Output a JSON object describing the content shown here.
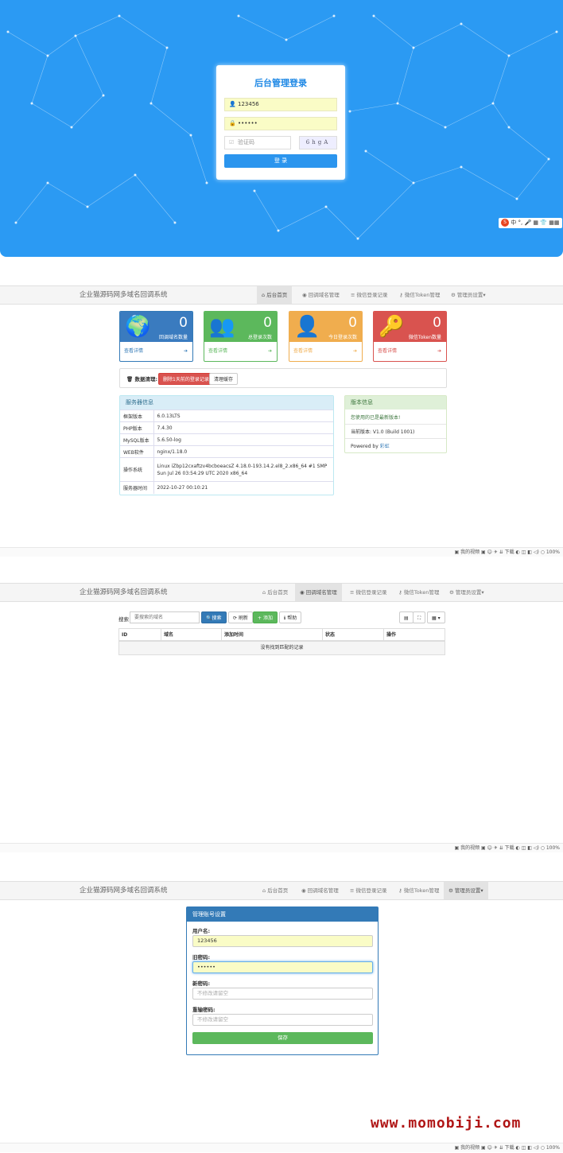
{
  "login": {
    "title": "后台管理登录",
    "username": "123456",
    "password": "••••••",
    "captcha_placeholder": "验证码",
    "captcha_text": "6hgA",
    "submit_label": "登 录"
  },
  "ime_toolbar": {
    "items": [
      "中",
      "°,",
      "🎤",
      "▦",
      "👕",
      "▦▦"
    ]
  },
  "nav": {
    "brand": "企业猫源码网多域名回调系统",
    "items": [
      "后台首页",
      "回调域名管理",
      "微信登录记录",
      "微信Token管理",
      "管理员设置▾"
    ]
  },
  "statusbar": {
    "text": "▣ 我的视频   ▣   ☺   ✈   ⇊ 下载   ◐   ◫   ◧   ◁)   ○ 100%"
  },
  "dashboard": {
    "cards": [
      {
        "num": "0",
        "label": "回调域名数量",
        "link": "查看详情",
        "icon": "globe-icon",
        "color": "#337ab7",
        "bg": "#3a7bbf"
      },
      {
        "num": "0",
        "label": "总登录次数",
        "link": "查看详情",
        "icon": "users-icon",
        "color": "#5cb85c",
        "bg": "#5cb85c"
      },
      {
        "num": "0",
        "label": "今日登录次数",
        "link": "查看详情",
        "icon": "user-icon",
        "color": "#f0ad4e",
        "bg": "#f0ad4e"
      },
      {
        "num": "0",
        "label": "微信Token数量",
        "link": "查看详情",
        "icon": "key-icon",
        "color": "#d9534f",
        "bg": "#d9534f"
      }
    ],
    "cleanup": {
      "label": "数据清理:",
      "delete_btn": "删除1天前的登录记录",
      "clear_btn": "清理缓存"
    },
    "server": {
      "title": "服务器信息",
      "rows": [
        {
          "k": "框架版本",
          "v": "6.0.13LTS"
        },
        {
          "k": "PHP版本",
          "v": "7.4.30"
        },
        {
          "k": "MySQL版本",
          "v": "5.6.50-log"
        },
        {
          "k": "WEB软件",
          "v": "nginx/1.18.0"
        },
        {
          "k": "操作系统",
          "v": "Linux iZbp12cxaftzv4bcboeacsZ 4.18.0-193.14.2.el8_2.x86_64 #1 SMP Sun Jul 26 03:54:29 UTC 2020 x86_64"
        },
        {
          "k": "服务器时间",
          "v": "2022-10-27 00:10:21"
        }
      ]
    },
    "version": {
      "title": "版本信息",
      "latest": "您使用的已是最新版本!",
      "current": "当前版本: V1.0 (Build 1001)",
      "powered_prefix": "Powered by ",
      "powered_link": "彩虹"
    }
  },
  "domains": {
    "search_label": "搜索",
    "search_placeholder": "要搜索的域名",
    "search_btn": "搜索",
    "refresh_btn": "刷新",
    "add_btn": "添加",
    "help_btn": "帮助",
    "columns": [
      "ID",
      "域名",
      "添加时间",
      "状态",
      "操作"
    ],
    "empty": "没有找到匹配的记录"
  },
  "admin_form": {
    "title": "管理账号设置",
    "username_label": "用户名:",
    "username_value": "123456",
    "old_pw_label": "旧密码:",
    "old_pw_value": "••••••",
    "new_pw_label": "新密码:",
    "new_pw_placeholder": "不修改请留空",
    "re_pw_label": "重输密码:",
    "re_pw_placeholder": "不修改请留空",
    "save_btn": "保存"
  },
  "watermark": "www.momobiji.com"
}
